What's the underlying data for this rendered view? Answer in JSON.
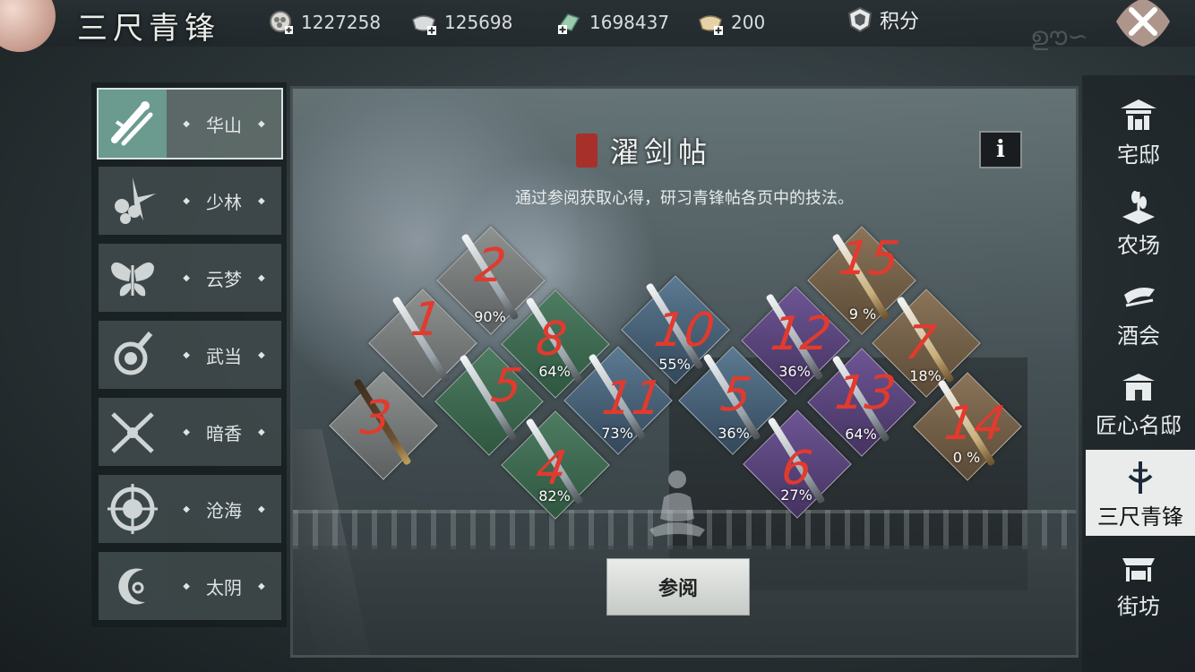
{
  "header": {
    "title": "三尺青锋",
    "resources": [
      {
        "icon": "coin-add-icon",
        "value": "1227258"
      },
      {
        "icon": "silver-ingot-add-icon",
        "value": "125698"
      },
      {
        "icon": "jade-add-icon",
        "value": "1698437"
      },
      {
        "icon": "gold-ingot-add-icon",
        "value": "200"
      }
    ],
    "score_label": "积分"
  },
  "sects": [
    {
      "name": "华山",
      "active": true,
      "icon": "huashan-sword-icon"
    },
    {
      "name": "少林",
      "active": false,
      "icon": "shaolin-icon"
    },
    {
      "name": "云梦",
      "active": false,
      "icon": "butterfly-icon"
    },
    {
      "name": "武当",
      "active": false,
      "icon": "taiji-icon"
    },
    {
      "name": "暗香",
      "active": false,
      "icon": "crossed-blades-icon"
    },
    {
      "name": "沧海",
      "active": false,
      "icon": "compass-wheel-icon"
    },
    {
      "name": "太阴",
      "active": false,
      "icon": "moon-icon"
    }
  ],
  "book": {
    "title": "濯剑帖",
    "info_label": "i",
    "subtitle": "通过参阅获取心得，研习青锋帖各页中的技法。",
    "consult_label": "参阅",
    "tiles": [
      {
        "id": "1",
        "color": "#7d8180",
        "percent": null,
        "scribble": "1"
      },
      {
        "id": "2",
        "color": "#7d8180",
        "percent": "90%",
        "scribble": "2"
      },
      {
        "id": "3",
        "color": "#7d8180",
        "percent": null,
        "scribble": "3"
      },
      {
        "id": "8",
        "color": "#3f6a51",
        "percent": "64%",
        "scribble": "8"
      },
      {
        "id": "5",
        "color": "#3f6a51",
        "percent": null,
        "scribble": "5"
      },
      {
        "id": "4",
        "color": "#3f6a51",
        "percent": "82%",
        "scribble": "4"
      },
      {
        "id": "10",
        "color": "#4d6a80",
        "percent": "55%",
        "scribble": "10"
      },
      {
        "id": "11",
        "color": "#4d6a80",
        "percent": "73%",
        "scribble": "11"
      },
      {
        "id": "9",
        "color": "#4d6a80",
        "percent": "36%",
        "scribble": "5"
      },
      {
        "id": "12",
        "color": "#5d4884",
        "percent": "36%",
        "scribble": "12"
      },
      {
        "id": "13",
        "color": "#5d4884",
        "percent": "64%",
        "scribble": "13"
      },
      {
        "id": "6",
        "color": "#5d4884",
        "percent": "27%",
        "scribble": "6"
      },
      {
        "id": "15",
        "color": "#7a664d",
        "percent": "9 %",
        "scribble": "15"
      },
      {
        "id": "7",
        "color": "#7a664d",
        "percent": "18%",
        "scribble": "7"
      },
      {
        "id": "14",
        "color": "#7a664d",
        "percent": "0 %",
        "scribble": "14"
      }
    ]
  },
  "nav": [
    {
      "label": "宅邸",
      "icon": "residence-icon",
      "active": false
    },
    {
      "label": "农场",
      "icon": "farm-icon",
      "active": false
    },
    {
      "label": "酒会",
      "icon": "banquet-icon",
      "active": false
    },
    {
      "label": "匠心名邸",
      "icon": "mansion-icon",
      "active": false
    },
    {
      "label": "三尺青锋",
      "icon": "sword-emblem-icon",
      "active": true
    },
    {
      "label": "街坊",
      "icon": "market-stall-icon",
      "active": false
    }
  ]
}
